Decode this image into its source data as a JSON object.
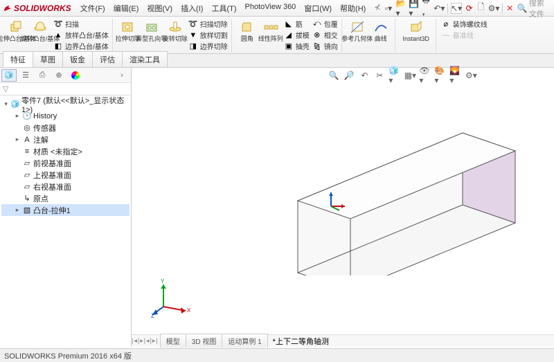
{
  "app": {
    "brand": "SOLIDWORKS"
  },
  "menus": [
    "文件(F)",
    "编辑(E)",
    "视图(V)",
    "插入(I)",
    "工具(T)",
    "PhotoView 360",
    "窗口(W)",
    "帮助(H)"
  ],
  "search_placeholder": "搜索文件",
  "ribbon": {
    "big1": [
      {
        "label": "拉伸凸台/基体",
        "icon": "extrude"
      },
      {
        "label": "旋转凸台/基体",
        "icon": "revolve"
      }
    ],
    "stack1": [
      {
        "label": "扫描",
        "icon": "sweep"
      },
      {
        "label": "放样凸台/基体",
        "icon": "loft"
      },
      {
        "label": "边界凸台/基体",
        "icon": "boundary"
      }
    ],
    "big2": [
      {
        "label": "拉伸切除",
        "icon": "cutextrude"
      },
      {
        "label": "异型孔向导",
        "icon": "holewiz"
      },
      {
        "label": "旋转切除",
        "icon": "cutrevolve"
      }
    ],
    "stack2": [
      {
        "label": "扫描切除",
        "icon": "sweepcut"
      },
      {
        "label": "放样切割",
        "icon": "loftcut"
      },
      {
        "label": "边界切除",
        "icon": "boundarycut"
      }
    ],
    "big3": [
      {
        "label": "圆角",
        "icon": "fillet"
      },
      {
        "label": "线性阵列",
        "icon": "pattern"
      }
    ],
    "stack3": [
      {
        "label": "筋",
        "icon": "rib"
      },
      {
        "label": "拔模",
        "icon": "draft"
      },
      {
        "label": "抽壳",
        "icon": "shell"
      }
    ],
    "stack4": [
      {
        "label": "包覆",
        "icon": "wrap"
      },
      {
        "label": "相交",
        "icon": "intersect"
      },
      {
        "label": "镜向",
        "icon": "mirror"
      }
    ],
    "big4": [
      {
        "label": "参考几何体",
        "icon": "refgeo"
      },
      {
        "label": "曲线",
        "icon": "curves"
      }
    ],
    "instant3d": {
      "label": "Instant3D",
      "icon": "instant3d"
    },
    "stack5": [
      {
        "label": "装饰螺纹线",
        "icon": "thread"
      },
      {
        "label": "基准线",
        "icon": "datum",
        "disabled": true
      }
    ]
  },
  "feature_tabs": [
    "特征",
    "草图",
    "钣金",
    "评估",
    "渲染工具"
  ],
  "side": {
    "root": "零件7 (默认<<默认>_显示状态 1>)",
    "nodes": [
      {
        "label": "History",
        "icon": "history"
      },
      {
        "label": "传感器",
        "icon": "sensor"
      },
      {
        "label": "注解",
        "icon": "annotation"
      },
      {
        "label": "材质 <未指定>",
        "icon": "material"
      },
      {
        "label": "前视基准面",
        "icon": "plane"
      },
      {
        "label": "上视基准面",
        "icon": "plane"
      },
      {
        "label": "右视基准面",
        "icon": "plane"
      },
      {
        "label": "原点",
        "icon": "origin"
      },
      {
        "label": "凸台-拉伸1",
        "icon": "extrude",
        "selected": true
      }
    ]
  },
  "viewport": {
    "tabs_left": "|◂|▸|◂|▸|",
    "tabs": [
      "模型",
      "3D 视图",
      "运动算例 1"
    ],
    "status_marker": "*上下二等角轴测"
  },
  "statusbar": "SOLIDWORKS Premium 2016 x64 版"
}
